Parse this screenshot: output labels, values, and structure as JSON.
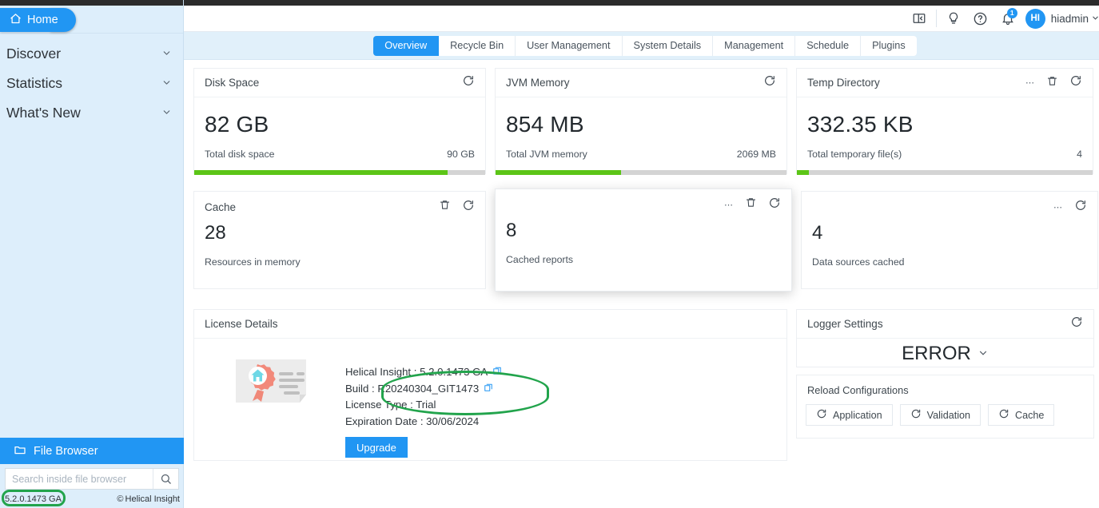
{
  "sidebar": {
    "home_label": "Home",
    "home_icon": "house-icon",
    "nav_items": [
      {
        "label": "Discover",
        "icon": "chevron-down-icon"
      },
      {
        "label": "Statistics",
        "icon": "chevron-down-icon"
      },
      {
        "label": "What's New",
        "icon": "chevron-down-icon"
      }
    ],
    "file_browser_label": "File Browser",
    "file_browser_icon": "folder-icon",
    "search_placeholder": "Search inside file browser",
    "search_value": "",
    "search_icon": "search-icon",
    "version": "5.2.0.1473 GA",
    "copyright": "Helical Insight",
    "copyright_symbol": "©"
  },
  "header": {
    "icons": [
      "panel-toggle-icon",
      "lightbulb-icon",
      "help-circle-icon",
      "bell-icon"
    ],
    "notification_count": "1",
    "avatar_initials": "HI",
    "username": "hiadmin",
    "username_chevron": "chevron-down-icon"
  },
  "tabs": [
    {
      "label": "Overview",
      "active": true
    },
    {
      "label": "Recycle Bin",
      "active": false
    },
    {
      "label": "User Management",
      "active": false
    },
    {
      "label": "System Details",
      "active": false
    },
    {
      "label": "Management",
      "active": false
    },
    {
      "label": "Schedule",
      "active": false
    },
    {
      "label": "Plugins",
      "active": false
    }
  ],
  "metrics": [
    {
      "title": "Disk Space",
      "value": "82 GB",
      "label": "Total disk space",
      "total": "90 GB",
      "percent": 87,
      "icons": [
        "refresh-icon"
      ]
    },
    {
      "title": "JVM Memory",
      "value": "854 MB",
      "label": "Total JVM memory",
      "total": "2069 MB",
      "percent": 43,
      "icons": [
        "refresh-icon"
      ]
    },
    {
      "title": "Temp Directory",
      "value": "332.35 KB",
      "label": "Total temporary file(s)",
      "total": "4",
      "percent": 4,
      "icons": [
        "more-dots-icon",
        "trash-icon",
        "refresh-icon"
      ]
    }
  ],
  "cache_cards": [
    {
      "title": "Cache",
      "value": "28",
      "label": "Resources in memory",
      "icons": [
        "trash-icon",
        "refresh-icon"
      ],
      "hovered": false
    },
    {
      "title": "",
      "value": "8",
      "label": "Cached reports",
      "icons": [
        "more-dots-icon",
        "trash-icon",
        "refresh-icon"
      ],
      "hovered": true
    },
    {
      "title": "",
      "value": "4",
      "label": "Data sources cached",
      "icons": [
        "more-dots-icon",
        "refresh-icon"
      ],
      "hovered": false
    }
  ],
  "license": {
    "card_title": "License Details",
    "illustration": "certificate-icon",
    "product_line": "Helical Insight : 5.2.0.1473 GA",
    "build_line": "Build : R20240304_GIT1473",
    "license_type_line": "License Type : Trial",
    "expiration_line": "Expiration Date : 30/06/2024",
    "copy_icon": "copy-icon",
    "upgrade_label": "Upgrade"
  },
  "logger": {
    "card_title": "Logger Settings",
    "refresh_icon": "refresh-icon",
    "level": "ERROR",
    "level_chevron": "chevron-down-icon"
  },
  "reload": {
    "title": "Reload Configurations",
    "buttons": [
      {
        "label": "Application",
        "icon": "refresh-icon"
      },
      {
        "label": "Validation",
        "icon": "refresh-icon"
      },
      {
        "label": "Cache",
        "icon": "refresh-icon"
      }
    ]
  },
  "colors": {
    "accent": "#2196f3",
    "progress": "#5cc517",
    "progress_track": "#d4d4d4",
    "sidebar_bg": "#ddeefb",
    "tabstrip_bg": "#e1f0fa",
    "annotation": "#22a44c"
  }
}
